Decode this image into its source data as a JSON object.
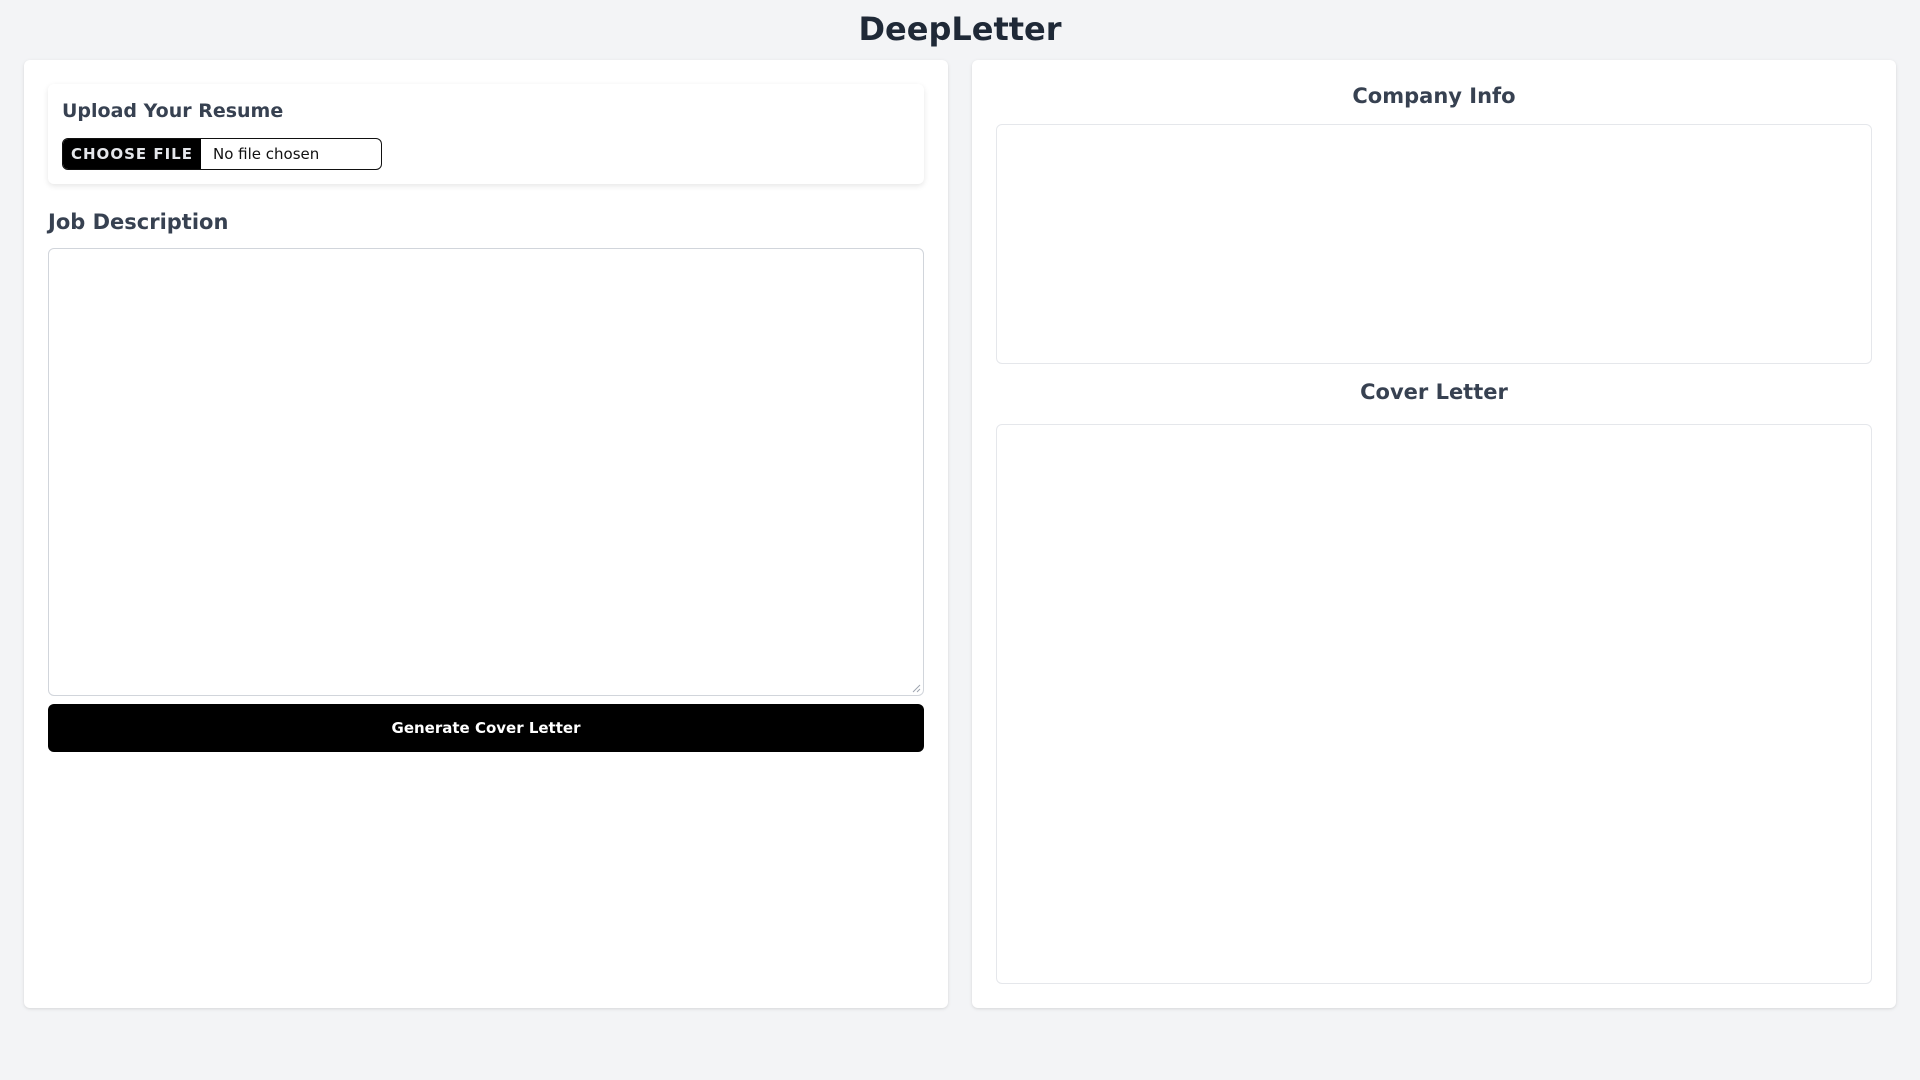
{
  "app": {
    "title": "DeepLetter"
  },
  "upload": {
    "title": "Upload Your Resume",
    "choose_file_label": "CHOOSE FILE",
    "file_status": "No file chosen"
  },
  "job_description": {
    "label": "Job Description",
    "value": ""
  },
  "actions": {
    "generate_label": "Generate Cover Letter"
  },
  "company_info": {
    "heading": "Company Info",
    "content": ""
  },
  "cover_letter": {
    "heading": "Cover Letter",
    "content": ""
  },
  "colors": {
    "background": "#f3f4f6",
    "panel": "#ffffff",
    "primary_button": "#000000",
    "heading_text": "#374151",
    "title_text": "#1f2937"
  }
}
